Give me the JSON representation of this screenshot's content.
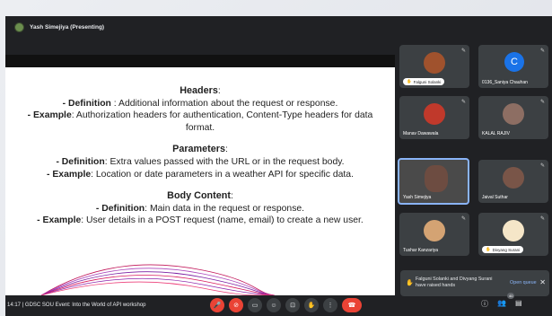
{
  "presenter": {
    "label": "Yash Simejiya (Presenting)"
  },
  "slide": {
    "headers_title": "Headers",
    "headers_def_label": "- Definition",
    "headers_def_text": " : Additional information about the request or response.",
    "headers_ex_label": "- Example",
    "headers_ex_text": ": Authorization headers for authentication, Content-Type headers for data",
    "headers_ex_text2": "format.",
    "params_title": "Parameters",
    "params_def_label": "- Definition",
    "params_def_text": ": Extra values passed with the URL or in the request body.",
    "params_ex_label": "- Example",
    "params_ex_text": ": Location or date parameters in a weather API for specific data.",
    "body_title": "Body Content",
    "body_def_label": "- Definition",
    "body_def_text": ": Main data in the request or response.",
    "body_ex_label": "- Example",
    "body_ex_text": ": User details in a POST request (name, email) to create a new user."
  },
  "participants": [
    {
      "name": "Falguni Solanki",
      "style": "pill"
    },
    {
      "name": "0136_Saniya Chauhan",
      "letter": "C"
    },
    {
      "name": "Manav Dawawala"
    },
    {
      "name": "KALAL RAJIV"
    },
    {
      "name": "Yash Simejiya"
    },
    {
      "name": "Jaival Suthar"
    },
    {
      "name": "Tushar Kanzariya"
    },
    {
      "name": "Divyang Surani",
      "style": "pill"
    }
  ],
  "toast": {
    "message": "Falguni Solanki and Divyang Surani have raised hands",
    "action": "Open queue"
  },
  "bottom": {
    "meeting": "14:17  |  GDSC SOU Event: Into the World of API workshop",
    "participant_count": "40"
  },
  "colors": {
    "accent": "#8ab4f8",
    "danger": "#ea4335",
    "tile": "#3c4043"
  }
}
